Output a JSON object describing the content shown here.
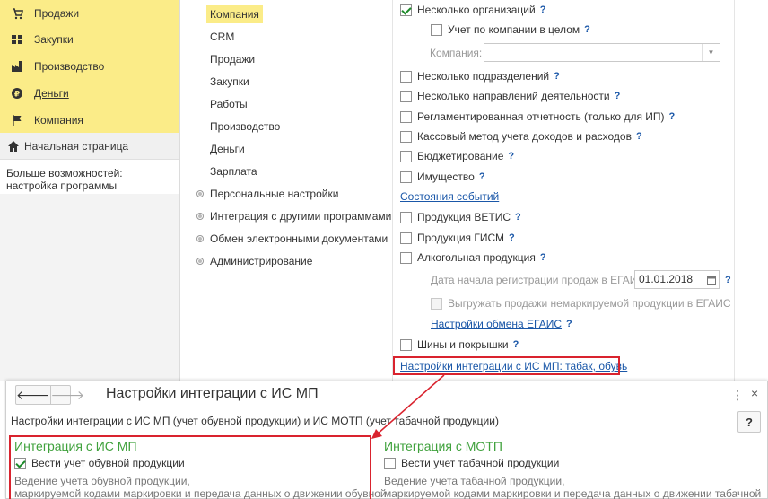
{
  "sections": [
    {
      "label": "Продажи",
      "icon": "sales-icon"
    },
    {
      "label": "Закупки",
      "icon": "purchases-icon"
    },
    {
      "label": "Производство",
      "icon": "production-icon"
    },
    {
      "label": "Деньги",
      "icon": "money-icon"
    },
    {
      "label": "Компания",
      "icon": "company-flag-icon"
    }
  ],
  "home": {
    "label": "Начальная страница"
  },
  "more": {
    "label": "Больше возможностей: настройка программы"
  },
  "nav": {
    "items": [
      "Компания",
      "CRM",
      "Продажи",
      "Закупки",
      "Работы",
      "Производство",
      "Деньги",
      "Зарплата"
    ],
    "groups": [
      "Персональные настройки",
      "Интеграция с другими программами",
      "Обмен электронными документами",
      "Администрирование"
    ]
  },
  "settings": {
    "multi_org": "Несколько организаций",
    "company_total": "Учет по компании в целом",
    "company_label": "Компания:",
    "multi_dept": "Несколько подразделений",
    "multi_dir": "Несколько направлений деятельности",
    "reg_report": "Регламентированная отчетность (только для ИП)",
    "cash_method": "Кассовый метод учета доходов и расходов",
    "budget": "Бюджетирование",
    "property": "Имущество",
    "event_states": "Состояния событий",
    "vetis": "Продукция ВЕТИС",
    "gism": "Продукция ГИСМ",
    "alcohol": "Алкогольная продукция",
    "egais_date_label": "Дата начала регистрации продаж в ЕГАИС:",
    "egais_date": "01.01.2018",
    "egais_unmarked": "Выгружать продажи немаркируемой продукции в ЕГАИС",
    "egais_settings": "Настройки обмена ЕГАИС",
    "tires": "Шины и покрышки",
    "ismp_settings": "Настройки интеграции с ИС МП: табак, обувь",
    "q": "?"
  },
  "dialog": {
    "back": "🡐",
    "forward": "🡒",
    "title": "Настройки интеграции с ИС МП",
    "menu": "⋮",
    "close": "×",
    "description": "Настройки интеграции с ИС МП (учет обувной продукции) и ИС МОТП (учет табачной продукции)",
    "help": "?",
    "left": {
      "header": "Интеграция с ИС МП",
      "checkbox": "Вести учет обувной продукции",
      "note1": "Ведение учета обувной продукции,",
      "note2": "маркируемой кодами маркировки и передача данных о движении обувной"
    },
    "right": {
      "header": "Интеграция с МОТП",
      "checkbox": "Вести учет табачной продукции",
      "note1": "Ведение учета табачной продукции,",
      "note2": "маркируемой кодами маркировки и передача данных о движении табачной"
    }
  },
  "colors": {
    "section_bg": "#fbec88",
    "link": "#1a57a8",
    "highlight": "#d9232e",
    "green": "#3fa13c"
  }
}
